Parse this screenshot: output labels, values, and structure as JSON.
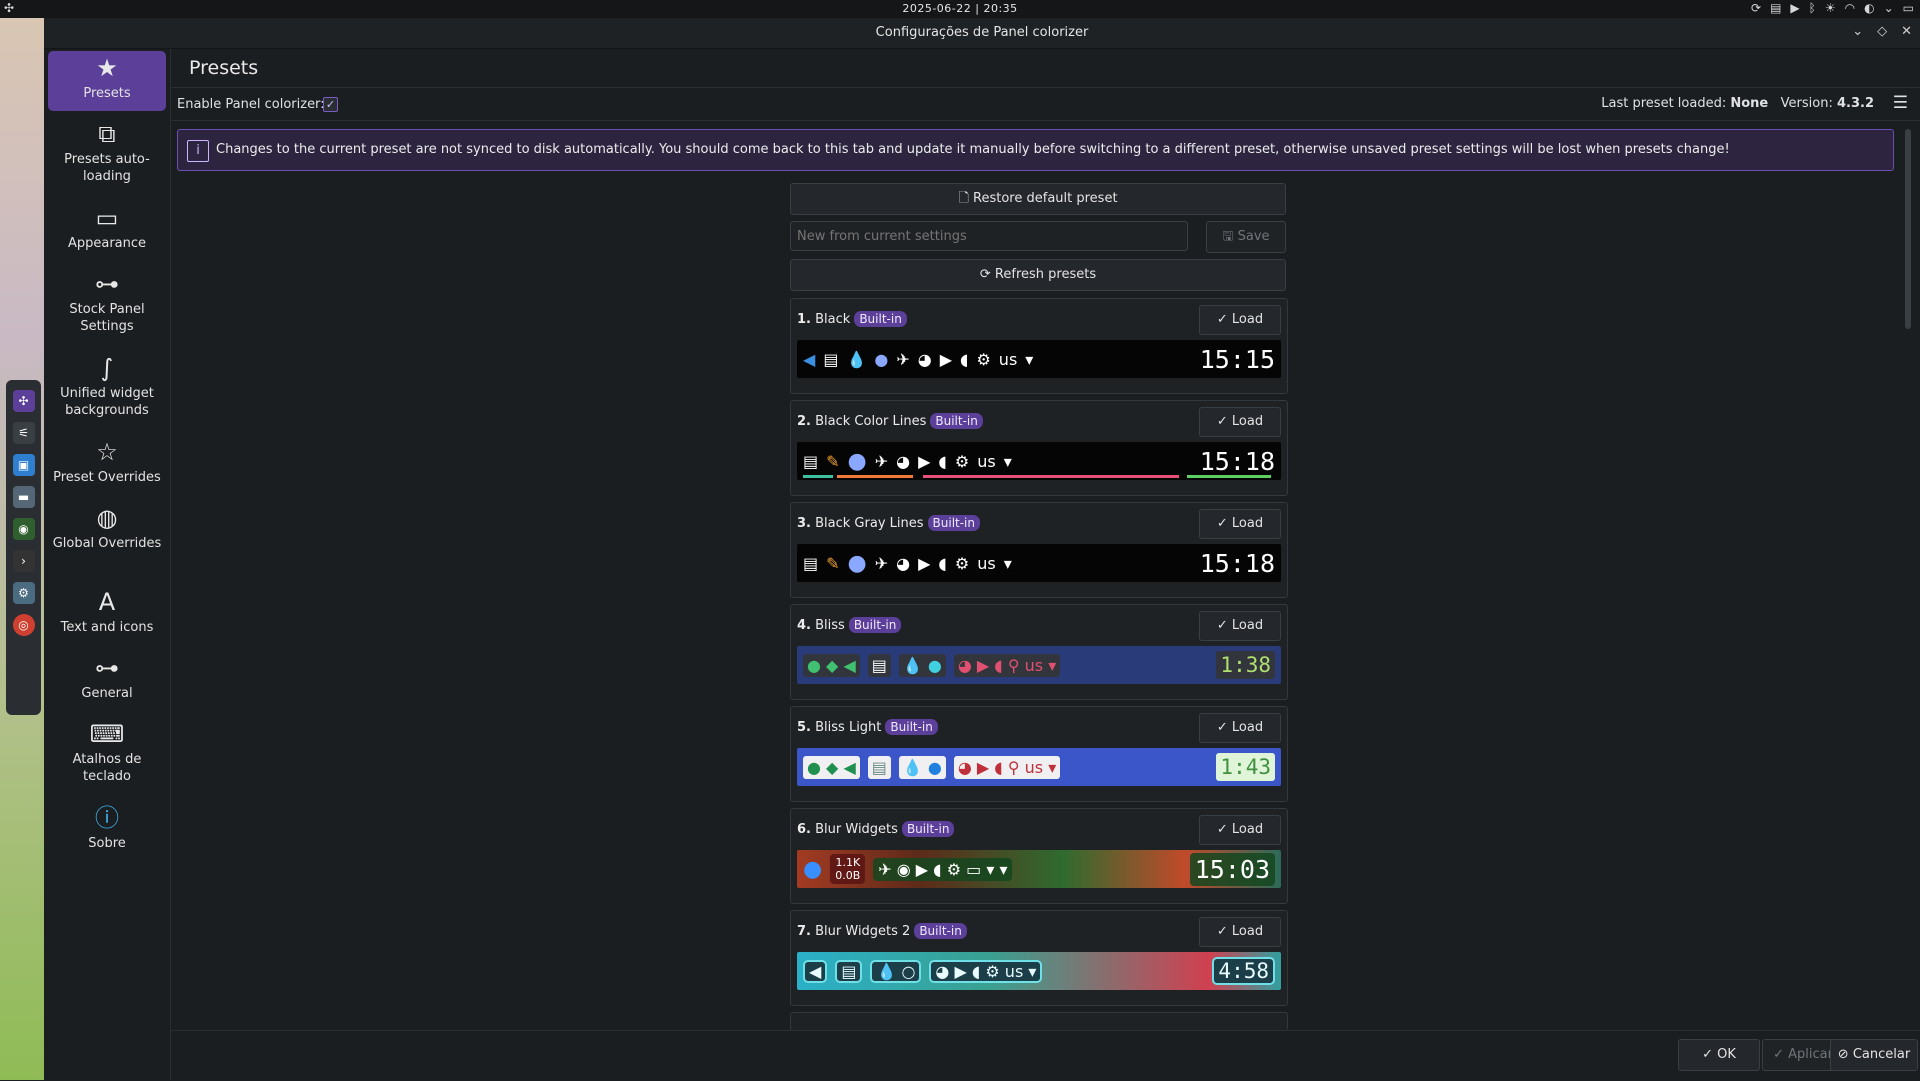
{
  "system_bar": {
    "datetime": "2025-06-22 | 20:35",
    "tray_icons": [
      "refresh-icon",
      "clipboard-icon",
      "media-icon",
      "bluetooth-icon",
      "brightness-icon",
      "wifi-icon",
      "volume-icon",
      "chevron-down-icon",
      "desktop-icon"
    ]
  },
  "window": {
    "title": "Configurações de Panel colorizer",
    "controls": [
      "minimize-icon",
      "maximize-icon",
      "close-icon"
    ]
  },
  "sidebar": {
    "items": [
      {
        "label": "Presets",
        "icon": "star-icon",
        "active": true
      },
      {
        "label": "Presets auto-loading",
        "icon": "play-window-icon"
      },
      {
        "label": "Appearance",
        "icon": "panel-icon"
      },
      {
        "label": "Stock Panel Settings",
        "icon": "slider-icon"
      },
      {
        "label": "Unified widget backgrounds",
        "icon": "curve-icon"
      },
      {
        "label": "Preset Overrides",
        "icon": "star-outline-icon"
      },
      {
        "label": "Global Overrides",
        "icon": "globe-icon"
      },
      {
        "label": "Text and icons",
        "icon": "text-icon"
      },
      {
        "label": "General",
        "icon": "slider-icon"
      },
      {
        "label": "Atalhos de teclado",
        "icon": "keyboard-icon"
      },
      {
        "label": "Sobre",
        "icon": "info-icon"
      }
    ]
  },
  "page": {
    "title": "Presets",
    "enable_label": "Enable Panel colorizer:",
    "enable_checked": true,
    "last_preset_label": "Last preset loaded:",
    "last_preset_value": "None",
    "version_label": "Version:",
    "version_value": "4.3.2"
  },
  "banner": {
    "text": "Changes to the current preset are not synced to disk automatically. You should come back to this tab and update it manually before switching to a different preset, otherwise unsaved preset settings will be lost when presets change!"
  },
  "actions": {
    "restore_label": "Restore default preset",
    "new_placeholder": "New from current settings",
    "save_label": "Save",
    "refresh_label": "Refresh presets"
  },
  "presets": [
    {
      "index": "1.",
      "name": "Black",
      "badge": "Built-in",
      "load": "Load",
      "time": "15:15",
      "lang": "us"
    },
    {
      "index": "2.",
      "name": "Black Color Lines",
      "badge": "Built-in",
      "load": "Load",
      "time": "15:18",
      "lang": "us"
    },
    {
      "index": "3.",
      "name": "Black Gray Lines",
      "badge": "Built-in",
      "load": "Load",
      "time": "15:18",
      "lang": "us"
    },
    {
      "index": "4.",
      "name": "Bliss",
      "badge": "Built-in",
      "load": "Load",
      "time": "1:38",
      "lang": "us"
    },
    {
      "index": "5.",
      "name": "Bliss Light",
      "badge": "Built-in",
      "load": "Load",
      "time": "1:43",
      "lang": "us"
    },
    {
      "index": "6.",
      "name": "Blur Widgets",
      "badge": "Built-in",
      "load": "Load",
      "time": "15:03",
      "net_up": "1.1K",
      "net_down": "0.0B"
    },
    {
      "index": "7.",
      "name": "Blur Widgets 2",
      "badge": "Built-in",
      "load": "Load",
      "time": "4:58",
      "lang": "us"
    }
  ],
  "footer": {
    "ok": "OK",
    "apply": "Aplicar",
    "cancel": "Cancelar"
  },
  "colors": {
    "accent": "#5b3f99",
    "banner_bg": "#2d2540",
    "window_bg": "#1b1e20"
  }
}
